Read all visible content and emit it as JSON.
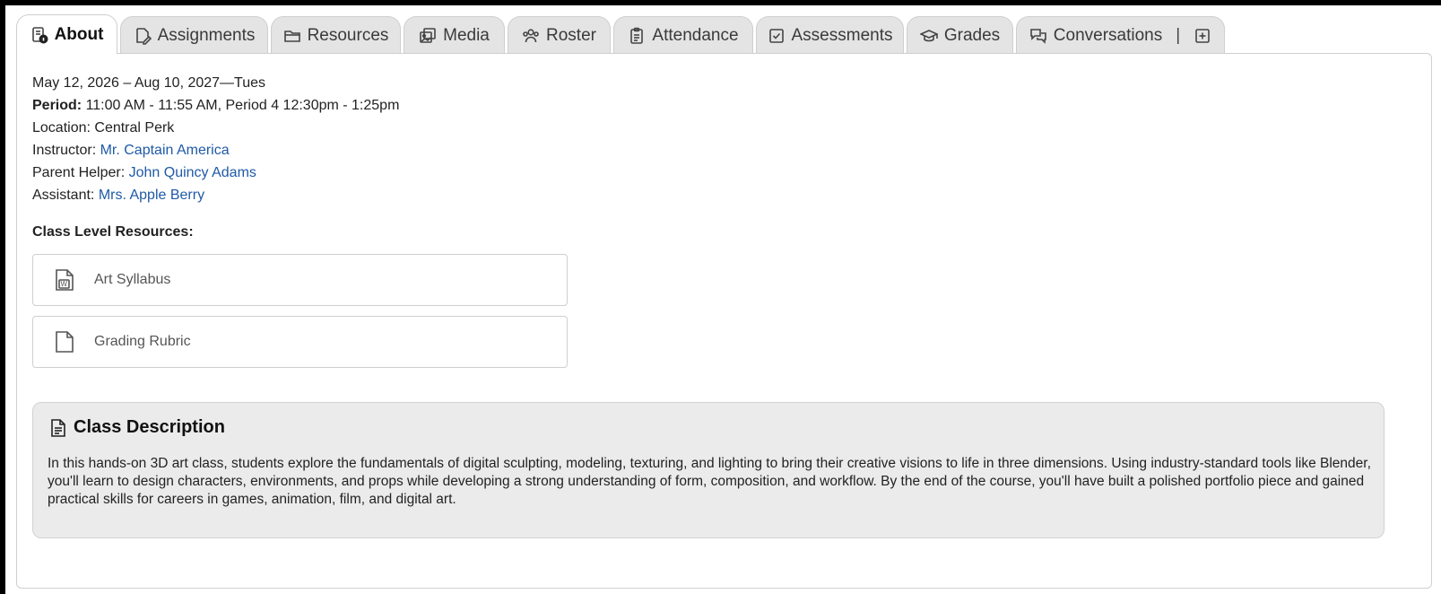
{
  "tabs": [
    {
      "label": "About",
      "icon": "about-info-icon",
      "active": true
    },
    {
      "label": "Assignments",
      "icon": "assignment-edit-icon",
      "active": false
    },
    {
      "label": "Resources",
      "icon": "folder-icon",
      "active": false
    },
    {
      "label": "Media",
      "icon": "media-gallery-icon",
      "active": false
    },
    {
      "label": "Roster",
      "icon": "people-icon",
      "active": false
    },
    {
      "label": "Attendance",
      "icon": "clipboard-icon",
      "active": false
    },
    {
      "label": "Assessments",
      "icon": "checkbox-icon",
      "active": false
    },
    {
      "label": "Grades",
      "icon": "graduation-cap-icon",
      "active": false
    },
    {
      "label": "Conversations",
      "icon": "chat-bubbles-icon",
      "active": false
    }
  ],
  "tab_separator": "|",
  "info": {
    "dates": "May 12, 2026 – Aug 10, 2027—Tues",
    "period_label": "Period:",
    "period_value": " 11:00 AM - 11:55 AM, Period 4 12:30pm - 1:25pm",
    "location": "Location: Central Perk",
    "instructor_label": "Instructor: ",
    "instructor_name": "Mr. Captain America",
    "parent_helper_label": "Parent Helper: ",
    "parent_helper_name": "John Quincy Adams",
    "assistant_label": "Assistant: ",
    "assistant_name": "Mrs. Apple Berry"
  },
  "resources": {
    "heading": "Class Level Resources:",
    "items": [
      {
        "label": "Art Syllabus",
        "icon": "word-document-icon"
      },
      {
        "label": "Grading Rubric",
        "icon": "document-icon"
      }
    ]
  },
  "description": {
    "title": "Class Description",
    "text": "In this hands-on 3D art class, students explore the fundamentals of digital sculpting, modeling, texturing, and lighting to bring their creative visions to life in three dimensions. Using industry-standard tools like Blender, you'll learn to design characters, environments, and props while developing a strong understanding of form, composition, and workflow. By the end of the course, you'll have built a polished portfolio piece and gained practical skills for careers in games, animation, film, and digital art."
  },
  "colors": {
    "link": "#1f5aa6",
    "tab_bg": "#e4e4e4",
    "desc_bg": "#ebebeb"
  }
}
